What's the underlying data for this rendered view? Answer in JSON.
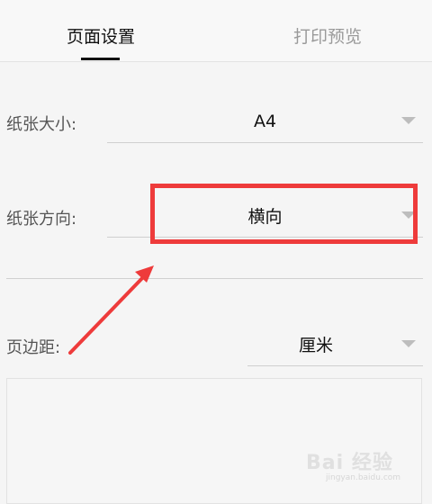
{
  "tabs": [
    {
      "label": "页面设置",
      "active": true
    },
    {
      "label": "打印预览",
      "active": false
    }
  ],
  "paper_size": {
    "label": "纸张大小:",
    "value": "A4"
  },
  "paper_orientation": {
    "label": "纸张方向:",
    "value": "横向"
  },
  "margin": {
    "label": "页边距:",
    "value": "厘米"
  },
  "annotation": {
    "color": "#ee3b3b",
    "type": "highlight-box-with-arrow"
  },
  "watermark": {
    "text": "Bai 经验",
    "url": "jingyan.baidu.com"
  },
  "icons": {
    "dropdown": "chevron-down-icon"
  }
}
